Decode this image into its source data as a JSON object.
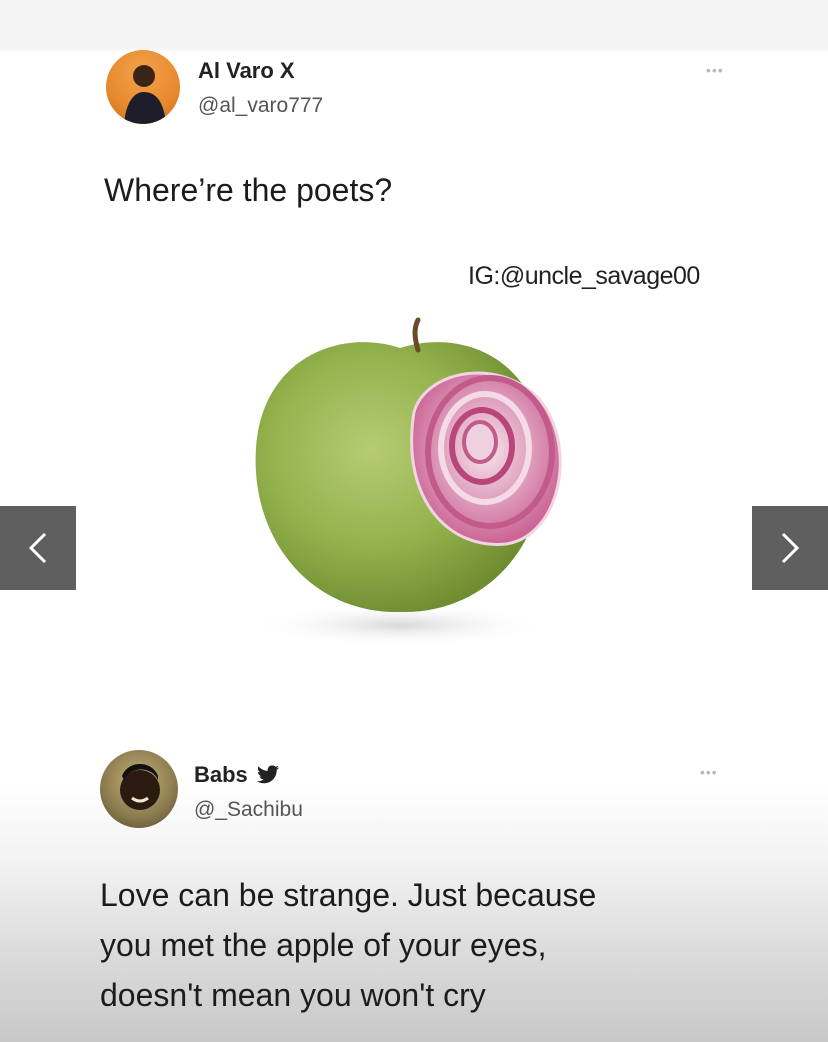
{
  "tweet1": {
    "display_name": "Al Varo X",
    "handle": "@al_varo777",
    "more": "•••",
    "text": "Where’re the poets?"
  },
  "media": {
    "watermark": "IG:@uncle_savage00",
    "prev_icon": "chevron-left-icon",
    "next_icon": "chevron-right-icon"
  },
  "tweet2": {
    "display_name": "Babs",
    "handle": "@_Sachibu",
    "more": "•••",
    "text_lines": [
      "Love can be strange. Just because",
      "you met the apple of your eyes,",
      "doesn't mean you won't cry"
    ]
  },
  "colors": {
    "twitter_bird": "#222222",
    "nav_bg": "#5f5f5f",
    "apple_green": "#8fb04a",
    "onion_purple": "#b0477a"
  }
}
